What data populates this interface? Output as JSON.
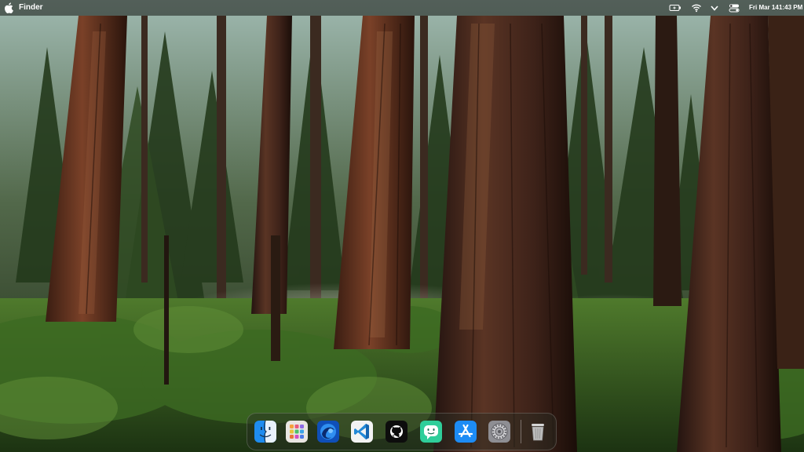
{
  "menubar": {
    "app_name": "Finder",
    "apple_icon": "apple-logo-icon",
    "status_icons": [
      "battery-charging-icon",
      "wifi-icon",
      "chevron-down-icon",
      "control-center-icon"
    ],
    "date": "Fri Mar 14",
    "time": "1:43 PM"
  },
  "desktop": {
    "wallpaper": "sequoia-forest-photo"
  },
  "dock": {
    "items": [
      {
        "name": "finder-icon",
        "accent": "#1e8cf0"
      },
      {
        "name": "launchpad-icon",
        "accent": "#e9e6e2"
      },
      {
        "name": "browser-icon",
        "accent": "#1a6fe0"
      },
      {
        "name": "vscode-icon",
        "accent": "#2389d7"
      },
      {
        "name": "github-icon",
        "accent": "#000000"
      },
      {
        "name": "messenger-app-icon",
        "accent": "#2fce9a"
      },
      {
        "name": "app-store-icon",
        "accent": "#1d8cf5"
      },
      {
        "name": "system-settings-icon",
        "accent": "#8e8e93"
      },
      {
        "name": "trash-icon",
        "accent": "#c8c8c8"
      }
    ]
  },
  "colors": {
    "menubar_bg": "#15170f",
    "forest_dark": "#1c2a16",
    "foliage": "#3f6e25",
    "bark": "#6b3a22"
  }
}
